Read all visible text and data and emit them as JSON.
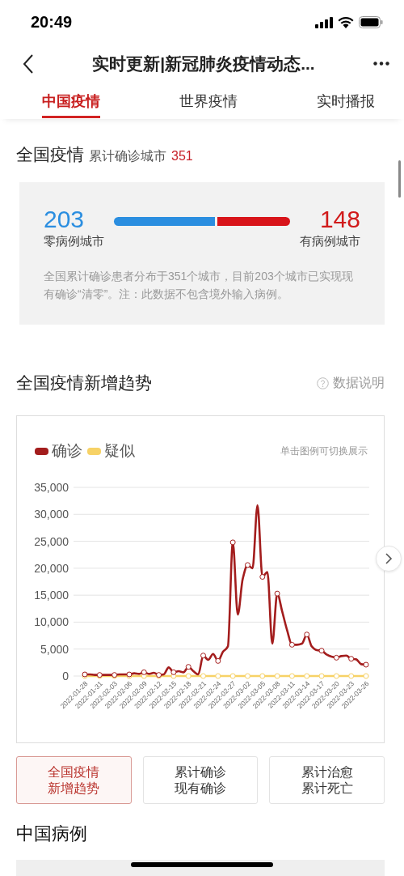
{
  "status_bar": {
    "time": "20:49"
  },
  "nav": {
    "title": "实时更新|新冠肺炎疫情动态..."
  },
  "tabs": [
    {
      "label": "中国疫情",
      "selected": true
    },
    {
      "label": "世界疫情",
      "selected": false
    },
    {
      "label": "实时播报",
      "selected": false
    }
  ],
  "summary": {
    "title": "全国疫情",
    "subtitle": "累计确诊城市",
    "count": "351",
    "zero_cities": {
      "value": "203",
      "label": "零病例城市"
    },
    "case_cities": {
      "value": "148",
      "label": "有病例城市"
    },
    "note": "全国累计确诊患者分布于351个城市，目前203个城市已实现现有确诊“清零”。注：此数据不包含境外输入病例。"
  },
  "trend": {
    "title": "全国疫情新增趋势",
    "help": "数据说明",
    "hint": "单击图例可切换展示",
    "chart_data": {
      "type": "line",
      "grid": true,
      "categories": [
        "2022-01-28",
        null,
        null,
        "2022-01-31",
        null,
        null,
        "2022-02-03",
        null,
        null,
        "2022-02-06",
        null,
        null,
        "2022-02-09",
        null,
        null,
        "2022-02-12",
        null,
        null,
        "2022-02-15",
        null,
        null,
        "2022-02-18",
        null,
        null,
        "2022-02-21",
        null,
        null,
        "2022-02-24",
        null,
        null,
        "2022-02-27",
        null,
        null,
        "2022-03-02",
        null,
        null,
        "2022-03-05",
        null,
        null,
        "2022-03-08",
        null,
        null,
        "2022-03-11",
        null,
        null,
        "2022-03-14",
        null,
        null,
        "2022-03-17",
        null,
        null,
        "2022-03-20",
        null,
        null,
        "2022-03-23",
        null,
        null,
        "2022-03-26"
      ],
      "series": [
        {
          "name": "确诊",
          "color": "#a31d1d",
          "values": [
            300,
            300,
            200,
            200,
            200,
            200,
            200,
            300,
            300,
            300,
            500,
            400,
            700,
            400,
            600,
            200,
            300,
            1600,
            700,
            900,
            700,
            1700,
            900,
            300,
            3800,
            3000,
            4100,
            2800,
            4500,
            5500,
            24800,
            11400,
            18000,
            20600,
            20000,
            31700,
            18400,
            19300,
            6000,
            15300,
            12000,
            8500,
            5800,
            5800,
            6000,
            7700,
            5500,
            4800,
            4700,
            4000,
            3600,
            3400,
            3700,
            3800,
            3200,
            3100,
            2200,
            2100
          ]
        },
        {
          "name": "疑似",
          "color": "#f7d266",
          "values": [
            0,
            0,
            0,
            0,
            0,
            0,
            0,
            0,
            0,
            0,
            0,
            0,
            0,
            0,
            0,
            0,
            0,
            0,
            0,
            0,
            0,
            0,
            0,
            0,
            0,
            0,
            0,
            0,
            0,
            0,
            0,
            0,
            0,
            0,
            0,
            0,
            0,
            0,
            0,
            0,
            0,
            0,
            0,
            0,
            0,
            0,
            0,
            0,
            0,
            0,
            0,
            0,
            0,
            0,
            0,
            0,
            0,
            0
          ]
        }
      ],
      "ylim": [
        0,
        35000
      ],
      "yticks": [
        {
          "value": 0,
          "label": "0"
        },
        {
          "value": 5000,
          "label": "5,000"
        },
        {
          "value": 10000,
          "label": "10,000"
        },
        {
          "value": 15000,
          "label": "15,000"
        },
        {
          "value": 20000,
          "label": "20,000"
        },
        {
          "value": 25000,
          "label": "25,000"
        },
        {
          "value": 30000,
          "label": "30,000"
        },
        {
          "value": 35000,
          "label": "35,000"
        }
      ]
    }
  },
  "views": [
    {
      "lines": [
        "全国疫情",
        "新增趋势"
      ],
      "selected": true
    },
    {
      "lines": [
        "累计确诊",
        "现有确诊"
      ],
      "selected": false
    },
    {
      "lines": [
        "累计治愈",
        "累计死亡"
      ],
      "selected": false
    }
  ],
  "cases": {
    "title": "中国病例"
  }
}
